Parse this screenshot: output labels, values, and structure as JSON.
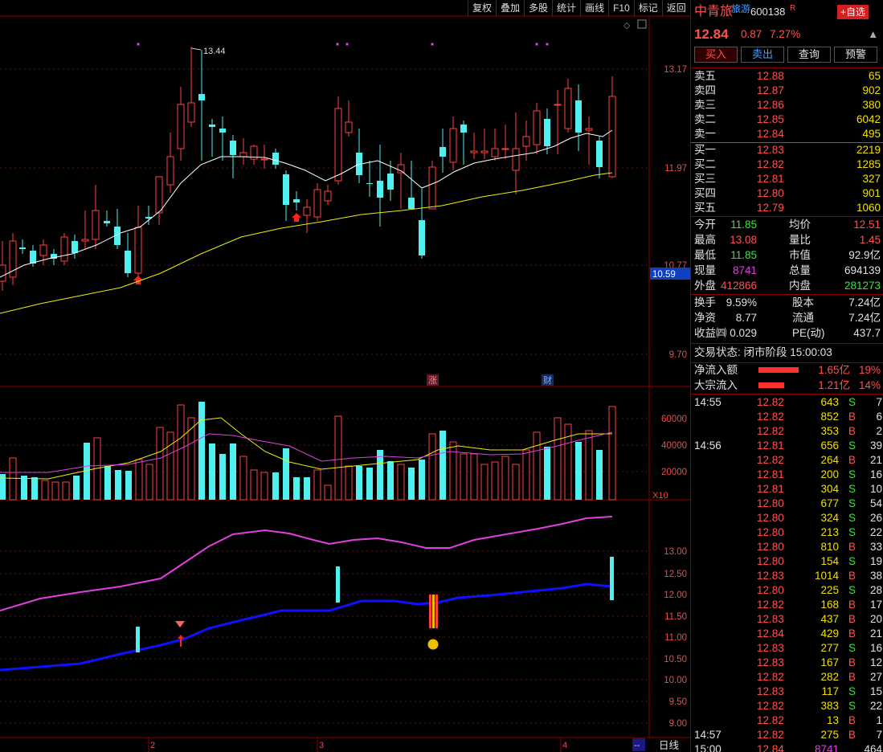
{
  "toolbar": [
    "复权",
    "叠加",
    "多股",
    "统计",
    "画线",
    "F10",
    "标记",
    "返回"
  ],
  "chart": {
    "price_labels": [
      "13.17",
      "11.97",
      "10.77",
      "9.70"
    ],
    "current_price_tag": "10.59",
    "high_label": "13.44",
    "markers": {
      "rise": "涨",
      "fin": "财"
    },
    "vol_labels": [
      "60000",
      "40000",
      "20000"
    ],
    "vol_unit": "X10",
    "ind_labels": [
      "13.00",
      "12.50",
      "12.00",
      "11.50",
      "11.00",
      "10.50",
      "10.00",
      "9.50",
      "9.00"
    ],
    "dates": [
      "2",
      "3",
      "4"
    ],
    "period": "日线",
    "corner": "--"
  },
  "quote": {
    "name": "中青旅",
    "tag": "旅游",
    "code": "600138",
    "r": "R",
    "add_btn": "+自选",
    "price": "12.84",
    "chg": "0.87",
    "pct": "7.27%",
    "buttons": [
      "买入",
      "卖出",
      "查询",
      "预警"
    ],
    "asks": [
      [
        "卖五",
        "12.88",
        "65"
      ],
      [
        "卖四",
        "12.87",
        "902"
      ],
      [
        "卖三",
        "12.86",
        "380"
      ],
      [
        "卖二",
        "12.85",
        "6042"
      ],
      [
        "卖一",
        "12.84",
        "495"
      ]
    ],
    "bids": [
      [
        "买一",
        "12.83",
        "2219"
      ],
      [
        "买二",
        "12.82",
        "1285"
      ],
      [
        "买三",
        "12.81",
        "327"
      ],
      [
        "买四",
        "12.80",
        "901"
      ],
      [
        "买五",
        "12.79",
        "1060"
      ]
    ],
    "stats": [
      [
        "今开",
        "11.85",
        "均价",
        "12.51"
      ],
      [
        "最高",
        "13.08",
        "量比",
        "1.45"
      ],
      [
        "最低",
        "11.85",
        "市值",
        "92.9亿"
      ],
      [
        "现量",
        "8741",
        "总量",
        "694139"
      ],
      [
        "外盘",
        "412866",
        "内盘",
        "281273"
      ]
    ],
    "stats2": [
      [
        "换手",
        "9.59%",
        "股本",
        "7.24亿"
      ],
      [
        "净资",
        "8.77",
        "流通",
        "7.24亿"
      ],
      [
        "收益㈣",
        "0.029",
        "PE(动)",
        "437.7"
      ]
    ],
    "status": "交易状态: 闭市阶段 15:00:03",
    "flows": [
      [
        "净流入额",
        "1.65亿",
        "19%"
      ],
      [
        "大宗流入",
        "1.21亿",
        "14%"
      ]
    ],
    "ticks": [
      [
        "14:55",
        "12.82",
        "643",
        "S",
        "7"
      ],
      [
        "",
        "12.82",
        "852",
        "B",
        "6"
      ],
      [
        "",
        "12.82",
        "353",
        "B",
        "2"
      ],
      [
        "14:56",
        "12.81",
        "656",
        "S",
        "39"
      ],
      [
        "",
        "12.82",
        "264",
        "B",
        "21"
      ],
      [
        "",
        "12.81",
        "200",
        "S",
        "16"
      ],
      [
        "",
        "12.81",
        "304",
        "S",
        "10"
      ],
      [
        "",
        "12.80",
        "677",
        "S",
        "54"
      ],
      [
        "",
        "12.80",
        "324",
        "S",
        "26"
      ],
      [
        "",
        "12.80",
        "213",
        "S",
        "22"
      ],
      [
        "",
        "12.80",
        "810",
        "B",
        "33"
      ],
      [
        "",
        "12.80",
        "154",
        "S",
        "19"
      ],
      [
        "",
        "12.83",
        "1014",
        "B",
        "38"
      ],
      [
        "",
        "12.80",
        "225",
        "S",
        "28"
      ],
      [
        "",
        "12.82",
        "168",
        "B",
        "17"
      ],
      [
        "",
        "12.83",
        "437",
        "B",
        "20"
      ],
      [
        "",
        "12.84",
        "429",
        "B",
        "21"
      ],
      [
        "",
        "12.83",
        "277",
        "S",
        "16"
      ],
      [
        "",
        "12.83",
        "167",
        "B",
        "12"
      ],
      [
        "",
        "12.82",
        "282",
        "B",
        "27"
      ],
      [
        "",
        "12.83",
        "117",
        "S",
        "15"
      ],
      [
        "",
        "12.82",
        "383",
        "S",
        "22"
      ],
      [
        "",
        "12.82",
        "13",
        "B",
        "1"
      ],
      [
        "14:57",
        "12.82",
        "275",
        "B",
        "7"
      ],
      [
        "15:00",
        "12.84",
        "8741",
        "",
        "464"
      ]
    ]
  }
}
